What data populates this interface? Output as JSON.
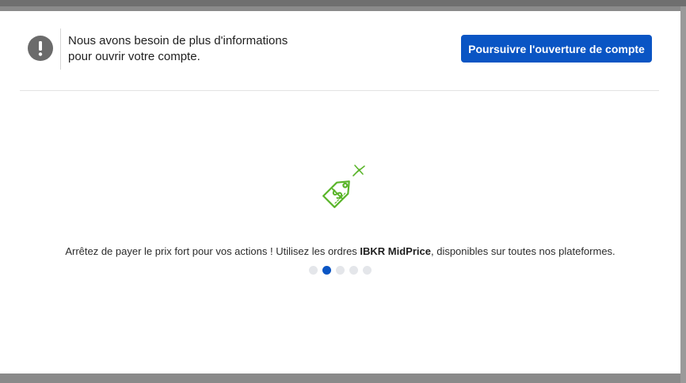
{
  "notice": {
    "icon": "exclamation-circle-icon",
    "line1": "Nous avons besoin de plus d'informations",
    "line2": "pour ouvrir votre compte.",
    "button_label": "Poursuivre l'ouverture de compte"
  },
  "carousel": {
    "icon": "price-tag-dollar-icon",
    "text_before": "Arrêtez de payer le prix fort pour vos actions ! Utilisez les ordres ",
    "text_bold": "IBKR MidPrice",
    "text_after": ", disponibles sur toutes nos plateformes.",
    "slide_count": 5,
    "active_slide": 2
  },
  "colors": {
    "accent": "#0a55c4",
    "icon_green": "#5ab52a",
    "alert_gray": "#6b6b6b"
  }
}
